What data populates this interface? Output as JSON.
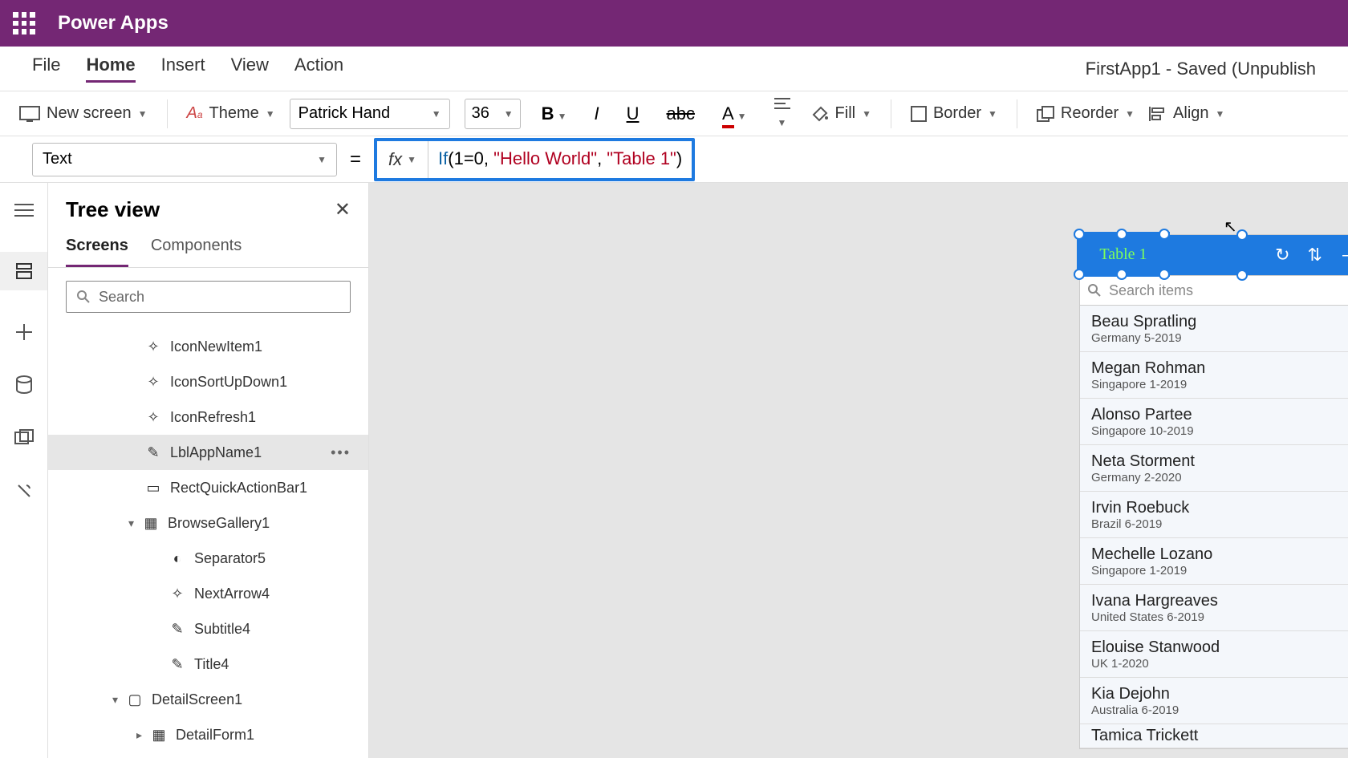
{
  "app_title": "Power Apps",
  "menu": {
    "file": "File",
    "home": "Home",
    "insert": "Insert",
    "view": "View",
    "action": "Action"
  },
  "save_status": "FirstApp1 - Saved (Unpublish",
  "toolbar": {
    "new_screen": "New screen",
    "theme": "Theme",
    "font_family": "Patrick Hand",
    "font_size": "36",
    "fill": "Fill",
    "border": "Border",
    "reorder": "Reorder",
    "align": "Align"
  },
  "formula": {
    "property": "Text",
    "fx_label": "fx",
    "expr_fn": "If",
    "expr_rest1": "(1=0, ",
    "expr_str1": "\"Hello World\"",
    "expr_rest2": ", ",
    "expr_str2": "\"Table 1\"",
    "expr_rest3": ")"
  },
  "tree": {
    "title": "Tree view",
    "tab_screens": "Screens",
    "tab_components": "Components",
    "search_placeholder": "Search",
    "items": [
      "IconNewItem1",
      "IconSortUpDown1",
      "IconRefresh1",
      "LblAppName1",
      "RectQuickActionBar1",
      "BrowseGallery1",
      "Separator5",
      "NextArrow4",
      "Subtitle4",
      "Title4",
      "DetailScreen1",
      "DetailForm1"
    ]
  },
  "preview": {
    "header_title": "Table 1",
    "search_placeholder": "Search items",
    "gallery": [
      {
        "title": "Beau Spratling",
        "sub": "Germany 5-2019"
      },
      {
        "title": "Megan Rohman",
        "sub": "Singapore 1-2019"
      },
      {
        "title": "Alonso Partee",
        "sub": "Singapore 10-2019"
      },
      {
        "title": "Neta Storment",
        "sub": "Germany 2-2020"
      },
      {
        "title": "Irvin Roebuck",
        "sub": "Brazil 6-2019"
      },
      {
        "title": "Mechelle Lozano",
        "sub": "Singapore 1-2019"
      },
      {
        "title": "Ivana Hargreaves",
        "sub": "United States 6-2019"
      },
      {
        "title": "Elouise Stanwood",
        "sub": "UK 1-2020"
      },
      {
        "title": "Kia Dejohn",
        "sub": "Australia 6-2019"
      },
      {
        "title": "Tamica Trickett",
        "sub": ""
      }
    ]
  }
}
